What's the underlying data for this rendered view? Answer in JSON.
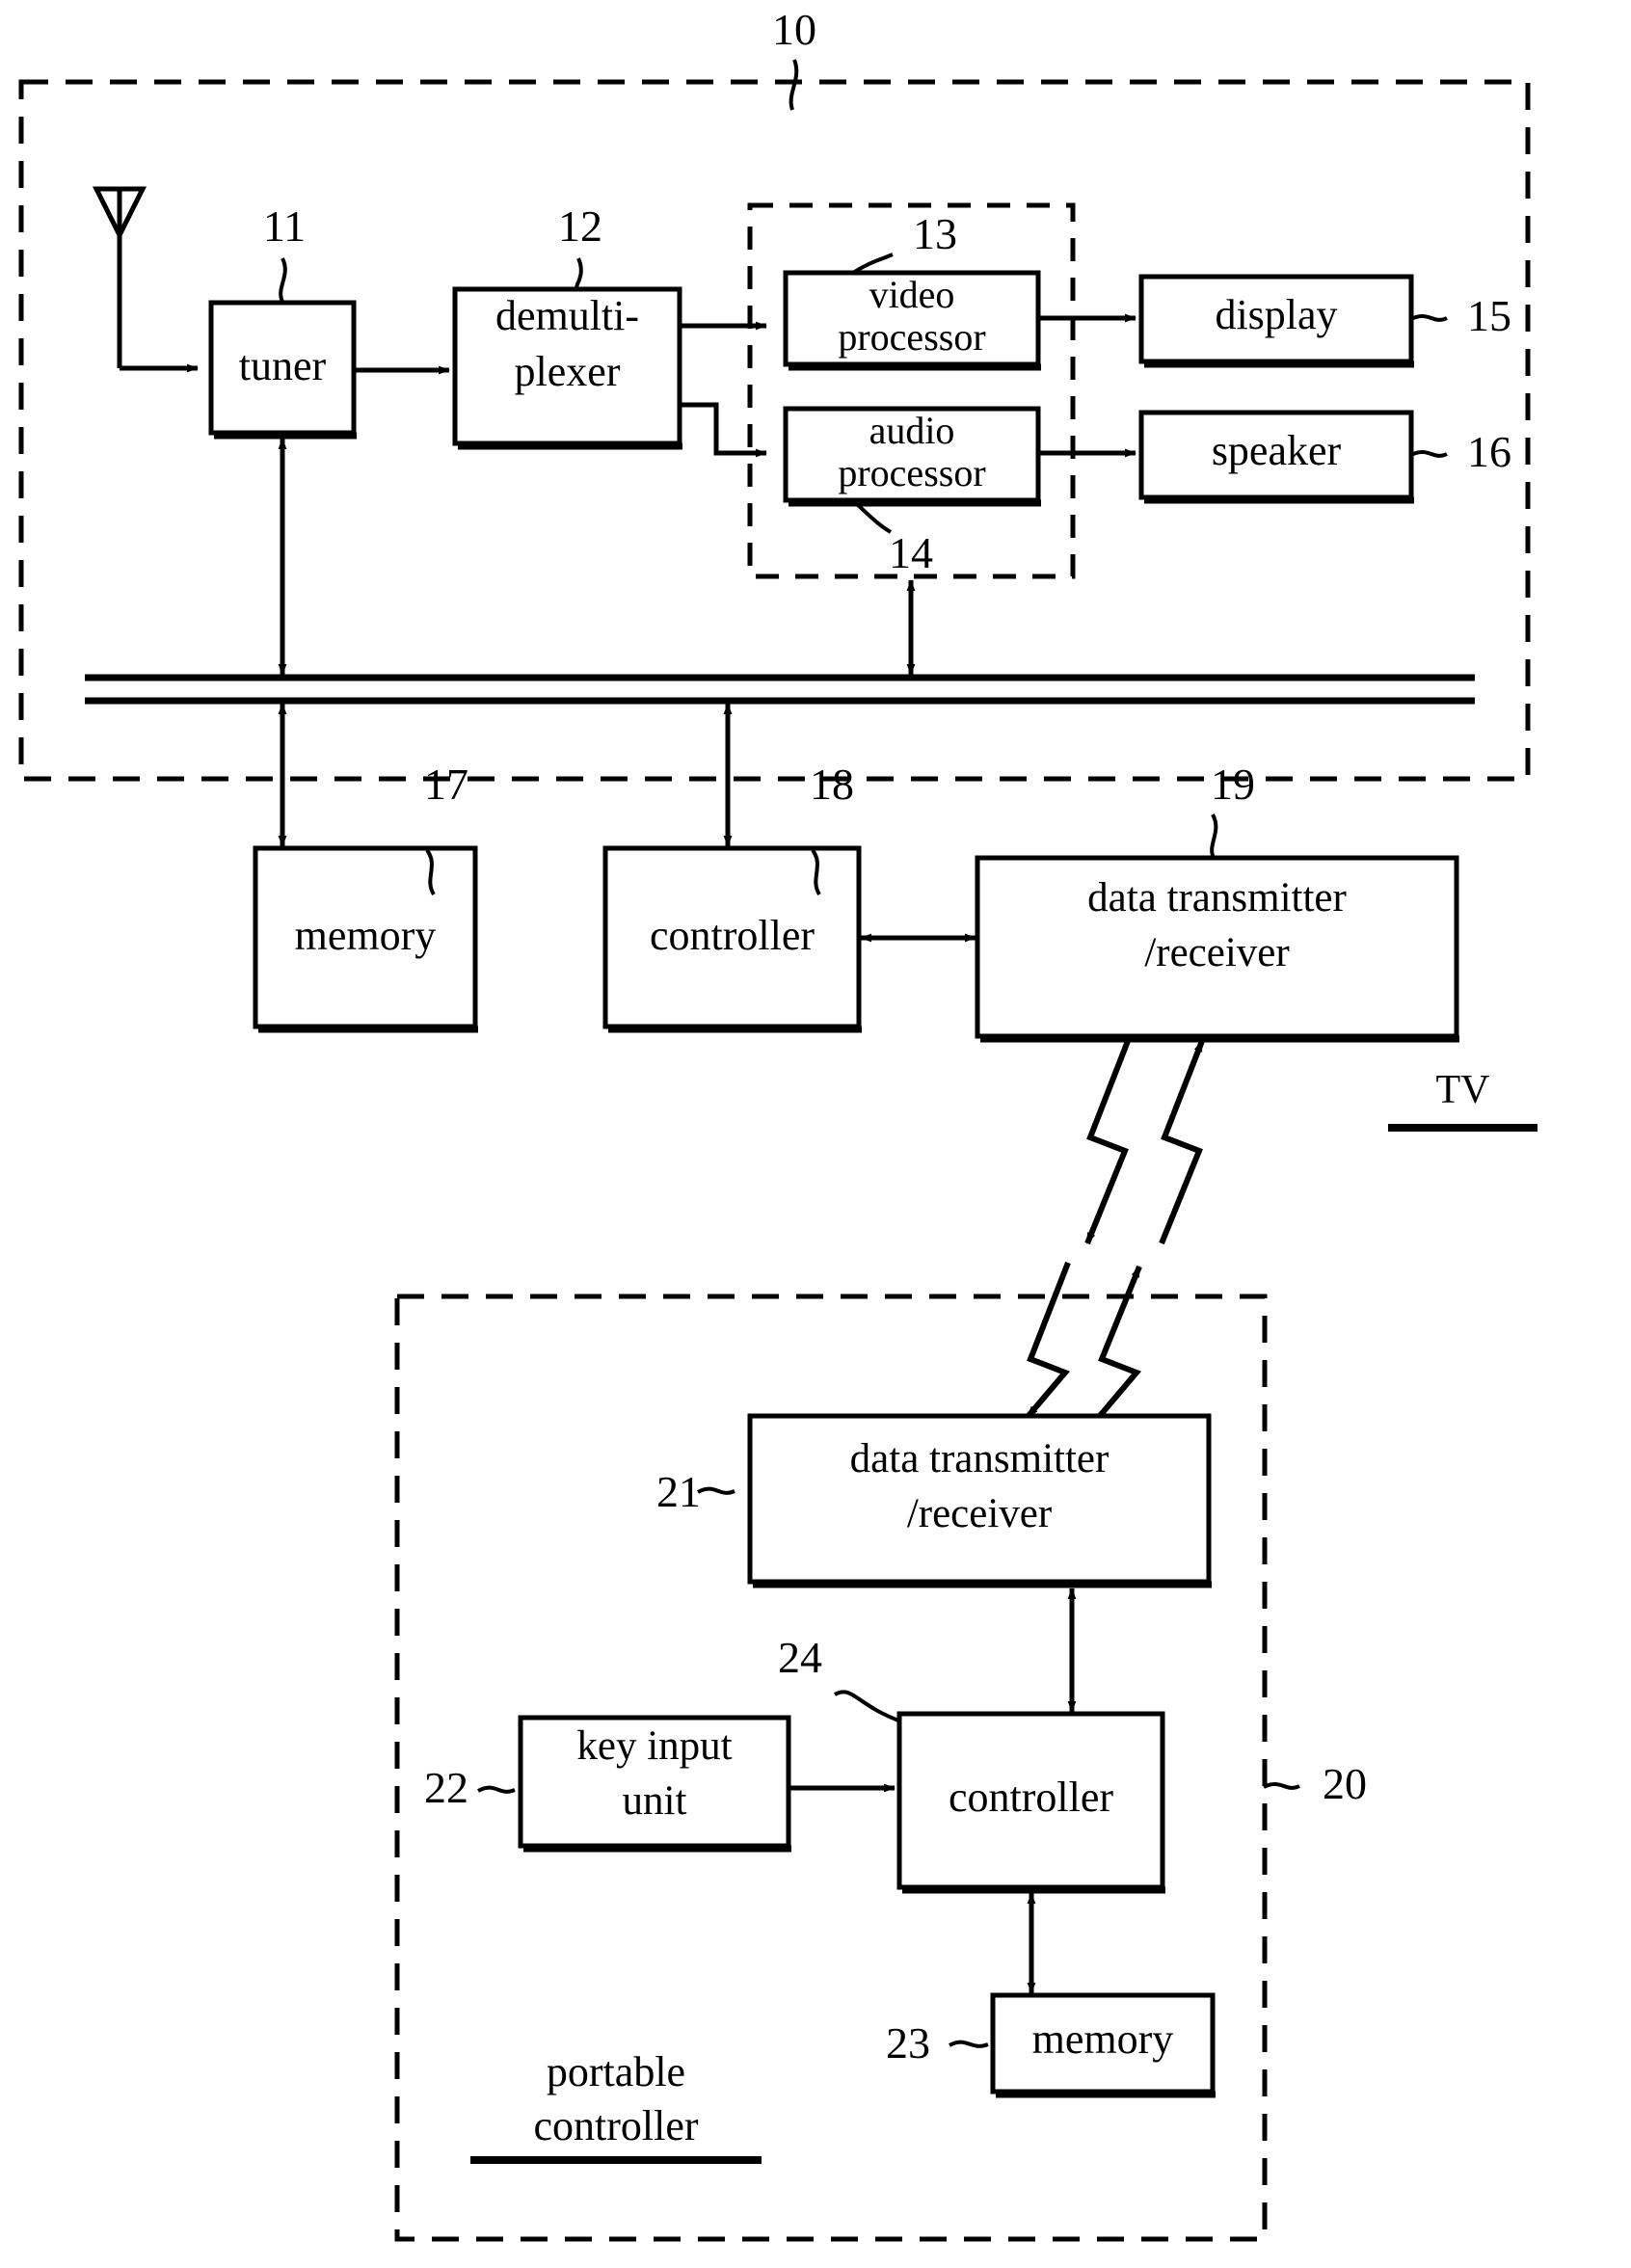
{
  "figure": {
    "type": "patent-block-diagram",
    "system_ref": "10",
    "device_refs": {
      "tv": "TV",
      "portable": "portable\ncontroller",
      "portable_ref": "20"
    }
  },
  "tv_section": {
    "ref": "10",
    "name_label": "TV",
    "blocks": [
      {
        "id": "tuner",
        "label": "tuner",
        "ref": "11"
      },
      {
        "id": "demux",
        "label": "demulti-\nplexer",
        "ref": "12"
      },
      {
        "id": "video_proc",
        "label": "video\nprocessor",
        "ref": "13"
      },
      {
        "id": "audio_proc",
        "label": "audio\nprocessor",
        "ref": "14"
      },
      {
        "id": "display",
        "label": "display",
        "ref": "15"
      },
      {
        "id": "speaker",
        "label": "speaker",
        "ref": "16"
      },
      {
        "id": "memory",
        "label": "memory",
        "ref": "17"
      },
      {
        "id": "controller",
        "label": "controller",
        "ref": "18"
      },
      {
        "id": "data_txrx",
        "label": "data transmitter\n/receiver",
        "ref": "19"
      }
    ]
  },
  "portable_section": {
    "ref": "20",
    "name_label": "portable\ncontroller",
    "blocks": [
      {
        "id": "p_data_txrx",
        "label": "data transmitter\n/receiver",
        "ref": "21"
      },
      {
        "id": "key_input",
        "label": "key input\nunit",
        "ref": "22"
      },
      {
        "id": "p_memory",
        "label": "memory",
        "ref": "23"
      },
      {
        "id": "p_controller",
        "label": "controller",
        "ref": "24"
      }
    ]
  },
  "labels": {
    "ref_10": "10",
    "ref_11": "11",
    "ref_12": "12",
    "ref_13": "13",
    "ref_14": "14",
    "ref_15": "15",
    "ref_16": "16",
    "ref_17": "17",
    "ref_18": "18",
    "ref_19": "19",
    "ref_20": "20",
    "ref_21": "21",
    "ref_22": "22",
    "ref_23": "23",
    "ref_24": "24",
    "tuner": "tuner",
    "demux_l1": "demulti-",
    "demux_l2": "plexer",
    "video_l1": "video",
    "video_l2": "processor",
    "audio_l1": "audio",
    "audio_l2": "processor",
    "display": "display",
    "speaker": "speaker",
    "memory": "memory",
    "controller": "controller",
    "data_l1": "data transmitter",
    "data_l2": "/receiver",
    "p_data_l1": "data transmitter",
    "p_data_l2": "/receiver",
    "key_l1": "key input",
    "key_l2": "unit",
    "p_memory": "memory",
    "p_controller": "controller",
    "tv": "TV",
    "portable_l1": "portable",
    "portable_l2": "controller"
  },
  "colors": {
    "stroke": "#000000",
    "background": "#ffffff"
  }
}
